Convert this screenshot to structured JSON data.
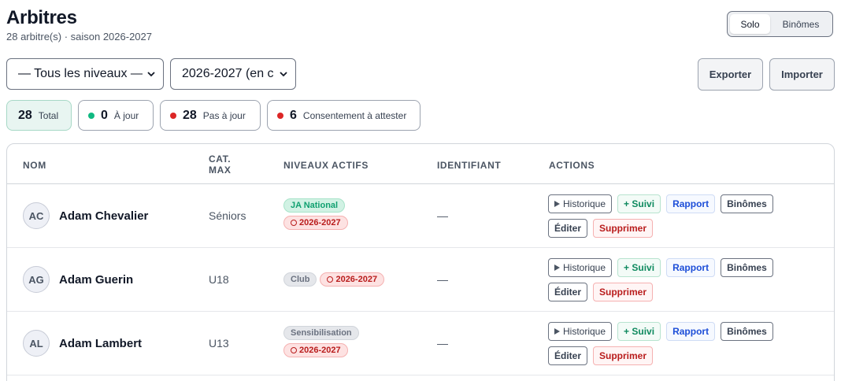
{
  "header": {
    "title": "Arbitres",
    "subtitle": "28 arbitre(s) · saison 2026-2027"
  },
  "view_toggle": {
    "solo": "Solo",
    "binomes": "Binômes",
    "selected": "Solo"
  },
  "filters": {
    "niveaux": "— Tous les niveaux —",
    "saison": "2026-2027 (en c"
  },
  "toolbar": {
    "export_label": "Exporter",
    "import_label": "Importer"
  },
  "stats": {
    "total": {
      "value": "28",
      "label": "Total"
    },
    "a_jour": {
      "value": "0",
      "label": "À jour",
      "color": "#10b981"
    },
    "pas_a_jour": {
      "value": "28",
      "label": "Pas à jour",
      "color": "#dc2626"
    },
    "consentement": {
      "value": "6",
      "label": "Consentement à attester",
      "color": "#dc2626"
    }
  },
  "table": {
    "headers": {
      "nom": "NOM",
      "cat_max": "CAT.\nMAX",
      "niveaux": "NIVEAUX ACTIFS",
      "identifiant": "IDENTIFIANT",
      "actions": "ACTIONS"
    },
    "action_labels": {
      "historique": "Historique",
      "suivi": "+ Suivi",
      "rapport": "Rapport",
      "binomes": "Binômes",
      "editer": "Éditer",
      "supprimer": "Supprimer"
    },
    "rows": [
      {
        "initials": "AC",
        "name": "Adam Chevalier",
        "cat": "Séniors",
        "level": "JA National",
        "season": "2026-2027",
        "identifiant": "—"
      },
      {
        "initials": "AG",
        "name": "Adam Guerin",
        "cat": "U18",
        "level": "Club",
        "season": "2026-2027",
        "identifiant": "—"
      },
      {
        "initials": "AL",
        "name": "Adam Lambert",
        "cat": "U13",
        "level": "Sensibilisation",
        "season": "2026-2027",
        "identifiant": "—"
      }
    ]
  }
}
